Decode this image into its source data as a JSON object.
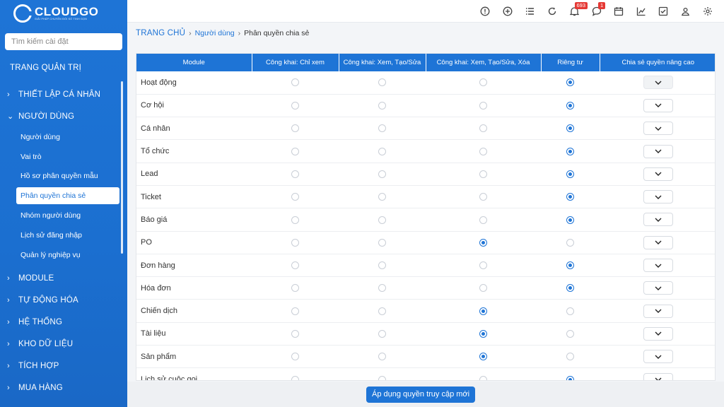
{
  "brand": {
    "name": "CLOUDGO",
    "tagline": "GIẢI PHÁP CHUYỂN ĐỔI SỐ TINH GỌN"
  },
  "sidebar": {
    "search_placeholder": "Tìm kiếm cài đặt",
    "admin_title": "TRANG QUẢN TRỊ",
    "sections": [
      {
        "label": "THIẾT LẬP CÁ NHÂN",
        "chevron": "›"
      },
      {
        "label": "NGƯỜI DÙNG",
        "chevron": "⌄"
      }
    ],
    "user_items": [
      {
        "label": "Người dùng"
      },
      {
        "label": "Vai trò"
      },
      {
        "label": "Hồ sơ phân quyền mẫu"
      },
      {
        "label": "Phân quyền chia sẻ",
        "active": true
      },
      {
        "label": "Nhóm người dùng"
      },
      {
        "label": "Lịch sử đăng nhập"
      },
      {
        "label": "Quản lý nghiệp vụ"
      }
    ],
    "more_sections": [
      {
        "label": "MODULE"
      },
      {
        "label": "TỰ ĐỘNG HÓA"
      },
      {
        "label": "HỆ THỐNG"
      },
      {
        "label": "KHO DỮ LIỆU"
      },
      {
        "label": "TÍCH HỢP"
      },
      {
        "label": "MUA HÀNG"
      }
    ]
  },
  "topbar": {
    "icons": [
      "info-icon",
      "add-icon",
      "list-icon",
      "refresh-icon",
      "notification-icon",
      "chat-icon",
      "calendar-icon",
      "report-icon",
      "task-icon",
      "user-icon",
      "settings-icon"
    ],
    "notification_count": "693",
    "chat_count": "1"
  },
  "breadcrumb": {
    "home": "TRANG CHỦ",
    "link": "Người dùng",
    "current": "Phân quyền chia sẻ"
  },
  "table": {
    "headers": [
      "Module",
      "Công khai: Chỉ xem",
      "Công khai: Xem, Tạo/Sửa",
      "Công khai: Xem, Tạo/Sửa, Xóa",
      "Riêng tư",
      "Chia sẻ quyền nâng cao"
    ],
    "rows": [
      {
        "module": "Hoạt động",
        "selected": 3,
        "advanced_disabled": true
      },
      {
        "module": "Cơ hội",
        "selected": 3
      },
      {
        "module": "Cá nhân",
        "selected": 3
      },
      {
        "module": "Tổ chức",
        "selected": 3
      },
      {
        "module": "Lead",
        "selected": 3
      },
      {
        "module": "Ticket",
        "selected": 3
      },
      {
        "module": "Báo giá",
        "selected": 3
      },
      {
        "module": "PO",
        "selected": 2
      },
      {
        "module": "Đơn hàng",
        "selected": 3
      },
      {
        "module": "Hóa đơn",
        "selected": 3
      },
      {
        "module": "Chiến dịch",
        "selected": 2
      },
      {
        "module": "Tài liệu",
        "selected": 2
      },
      {
        "module": "Sản phẩm",
        "selected": 2
      },
      {
        "module": "Lịch sử cuộc gọi",
        "selected": 3
      }
    ]
  },
  "footer": {
    "apply_label": "Áp dụng quyền truy cập mới"
  },
  "colors": {
    "primary": "#1e74d6",
    "badge": "#e53935"
  }
}
